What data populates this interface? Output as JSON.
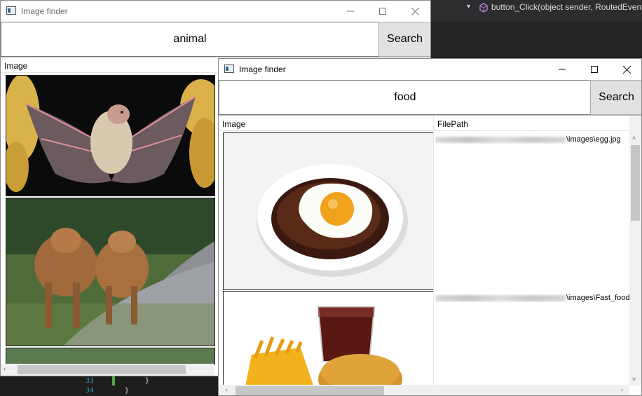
{
  "ide": {
    "method_signature": "button_Click(object sender, RoutedEventA",
    "line_numbers": [
      "33",
      "34"
    ],
    "code_brace_33": "}",
    "code_brace_34": "}"
  },
  "back_window": {
    "title": "Image finder",
    "query": "animal",
    "search_label": "Search",
    "column_image": "Image"
  },
  "front_window": {
    "title": "Image finder",
    "query": "food",
    "search_label": "Search",
    "column_image": "Image",
    "column_path": "FilePath",
    "rows": [
      {
        "path_suffix": "\\images\\egg.jpg"
      },
      {
        "path_suffix": "\\images\\Fast_food"
      }
    ]
  },
  "icons": {
    "minimize": "minimize-icon",
    "maximize": "maximize-icon",
    "close": "close-icon",
    "app": "window-app-icon",
    "method": "method-icon"
  },
  "colors": {
    "ide_bg": "#1e1e1e",
    "button_face": "#e1e1e1",
    "scroll_thumb": "#c6c6c6"
  }
}
